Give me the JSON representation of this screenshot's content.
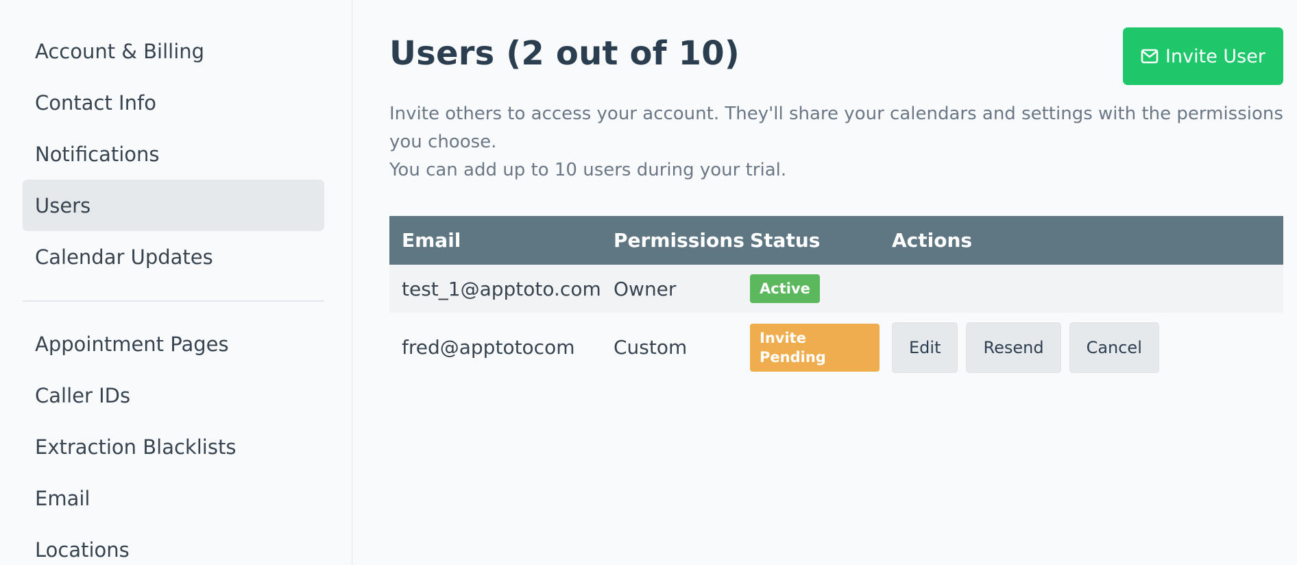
{
  "sidebar": {
    "primary_items": [
      {
        "label": "Account & Billing",
        "active": false
      },
      {
        "label": "Contact Info",
        "active": false
      },
      {
        "label": "Notifications",
        "active": false
      },
      {
        "label": "Users",
        "active": true
      },
      {
        "label": "Calendar Updates",
        "active": false
      }
    ],
    "secondary_items": [
      {
        "label": "Appointment Pages"
      },
      {
        "label": "Caller IDs"
      },
      {
        "label": "Extraction Blacklists"
      },
      {
        "label": "Email"
      },
      {
        "label": "Locations"
      }
    ]
  },
  "main": {
    "title": "Users (2 out of 10)",
    "invite_button": {
      "label": "Invite User",
      "icon": "envelope-icon",
      "color": "#1ec76a"
    },
    "description_line1": "Invite others to access your account. They'll share your calendars and settings with the permissions you choose.",
    "description_line2": "You can add up to 10 users during your trial."
  },
  "table": {
    "headers": {
      "email": "Email",
      "permissions": "Permissions",
      "status": "Status",
      "actions": "Actions"
    },
    "header_color": "#5f7683",
    "rows": [
      {
        "email": "test_1@apptoto.com",
        "permissions": "Owner",
        "status": "Active",
        "status_color": "#5cb85c"
      },
      {
        "email": "fred@apptotocom",
        "permissions": "Custom",
        "status": "Invite Pending",
        "status_color": "#f0ad4e",
        "actions": {
          "edit": "Edit",
          "resend": "Resend",
          "cancel": "Cancel"
        }
      }
    ]
  }
}
